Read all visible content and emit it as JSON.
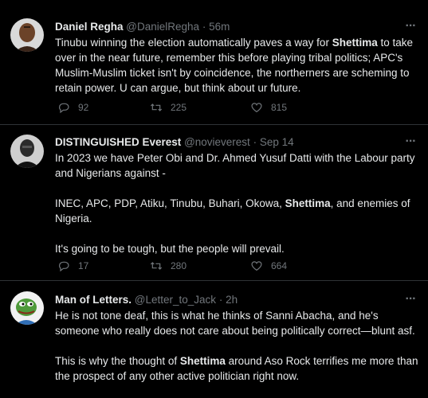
{
  "tweets": [
    {
      "name": "Daniel Regha",
      "handle": "@DanielRegha",
      "time": "56m",
      "text_parts": [
        [
          {
            "t": "Tinubu winning the election automatically paves a way for "
          },
          {
            "t": "Shettima",
            "b": true
          },
          {
            "t": " to take over in the near future, remember this before playing tribal politics; APC's Muslim-Muslim ticket isn't by coincidence, the northerners are scheming to retain power. U can argue, but think about ur future."
          }
        ]
      ],
      "replies": "92",
      "retweets": "225",
      "likes": "815"
    },
    {
      "name": "DISTINGUISHED Everest",
      "handle": "@novieverest",
      "time": "Sep 14",
      "text_parts": [
        [
          {
            "t": "In 2023 we have Peter Obi and Dr. Ahmed Yusuf Datti with the Labour party and Nigerians against -"
          }
        ],
        [
          {
            "t": "INEC, APC, PDP, Atiku, Tinubu, Buhari, Okowa, "
          },
          {
            "t": "Shettima",
            "b": true
          },
          {
            "t": ", and enemies of Nigeria."
          }
        ],
        [
          {
            "t": "It's going to be tough, but the people will prevail."
          }
        ]
      ],
      "replies": "17",
      "retweets": "280",
      "likes": "664"
    },
    {
      "name": "Man of Letters.",
      "handle": "@Letter_to_Jack",
      "time": "2h",
      "text_parts": [
        [
          {
            "t": "He is not tone deaf, this is what he thinks of Sanni Abacha, and he's someone who really does not care about being politically correct—blunt asf."
          }
        ],
        [
          {
            "t": "This is why the thought of "
          },
          {
            "t": "Shettima",
            "b": true
          },
          {
            "t": " around Aso Rock terrifies me more than the prospect of any other active politician right now."
          }
        ]
      ],
      "replies": "",
      "retweets": "",
      "likes": ""
    }
  ],
  "separator": "·",
  "more_label": "···",
  "icons": {
    "reply": "reply-icon",
    "retweet": "retweet-icon",
    "like": "heart-icon",
    "more": "more-icon"
  }
}
